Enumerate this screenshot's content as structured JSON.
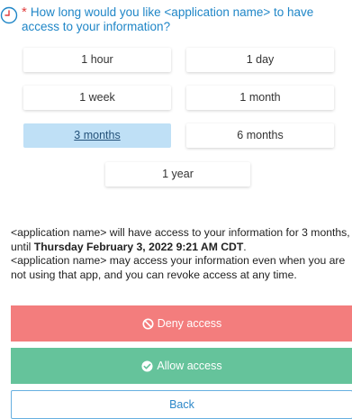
{
  "question": {
    "required_marker": "*",
    "text": "How long would you like <application name> to have access to your information?"
  },
  "options": [
    {
      "label": "1 hour",
      "selected": false
    },
    {
      "label": "1 day",
      "selected": false
    },
    {
      "label": "1 week",
      "selected": false
    },
    {
      "label": "1 month",
      "selected": false
    },
    {
      "label": "3 months",
      "selected": true
    },
    {
      "label": "6 months",
      "selected": false
    },
    {
      "label": "1 year",
      "selected": false
    }
  ],
  "info": {
    "line1_prefix": "<application name> will have access to your information for 3 months, until ",
    "line1_date": "Thursday February 3, 2022 9:21 AM CDT",
    "line1_suffix": ".",
    "line2": "<application name> may access your information even when you are not using that app, and you can revoke access at any time."
  },
  "buttons": {
    "deny_label": "Deny access",
    "allow_label": "Allow access",
    "back_label": "Back"
  },
  "icons": {
    "question": "clock-icon",
    "deny": "ban-icon",
    "allow": "check-circle-icon"
  },
  "colors": {
    "question_text": "#1f86c7",
    "selected_option_bg": "#bfe0f6",
    "deny_bg": "#f37d7d",
    "allow_bg": "#65c39b",
    "back_text": "#2b87c8"
  }
}
